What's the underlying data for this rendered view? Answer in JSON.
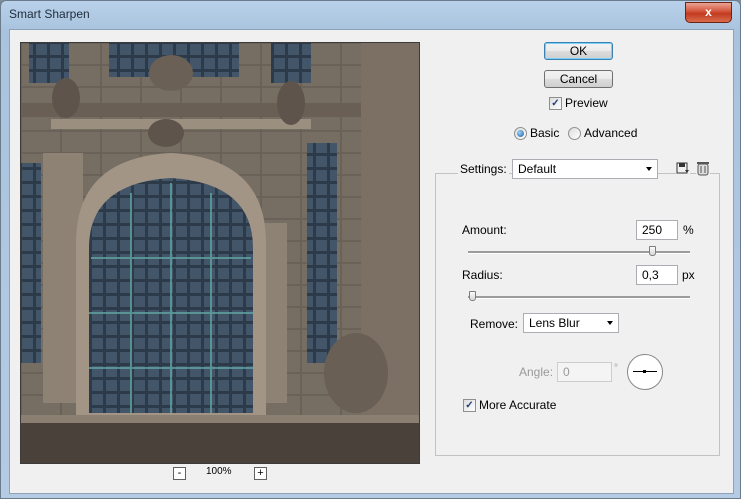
{
  "window": {
    "title": "Smart Sharpen",
    "close_glyph": "x"
  },
  "buttons": {
    "ok": "OK",
    "cancel": "Cancel"
  },
  "preview_toggle": {
    "label": "Preview",
    "checked": true
  },
  "mode": {
    "basic_label": "Basic",
    "advanced_label": "Advanced",
    "selected": "basic"
  },
  "settings": {
    "label": "Settings:",
    "value": "Default",
    "save_icon": "save-settings-icon",
    "delete_icon": "trash-icon"
  },
  "amount": {
    "label": "Amount:",
    "value": "250",
    "unit": "%",
    "slider_fraction": 0.83
  },
  "radius": {
    "label": "Radius:",
    "value": "0,3",
    "unit": "px",
    "slider_fraction": 0.02
  },
  "remove": {
    "label": "Remove:",
    "value": "Lens Blur"
  },
  "angle": {
    "label": "Angle:",
    "value": "0",
    "unit": "°"
  },
  "more_accurate": {
    "label": "More Accurate",
    "checked": true
  },
  "zoom": {
    "minus": "-",
    "plus": "+",
    "level": "100%"
  }
}
